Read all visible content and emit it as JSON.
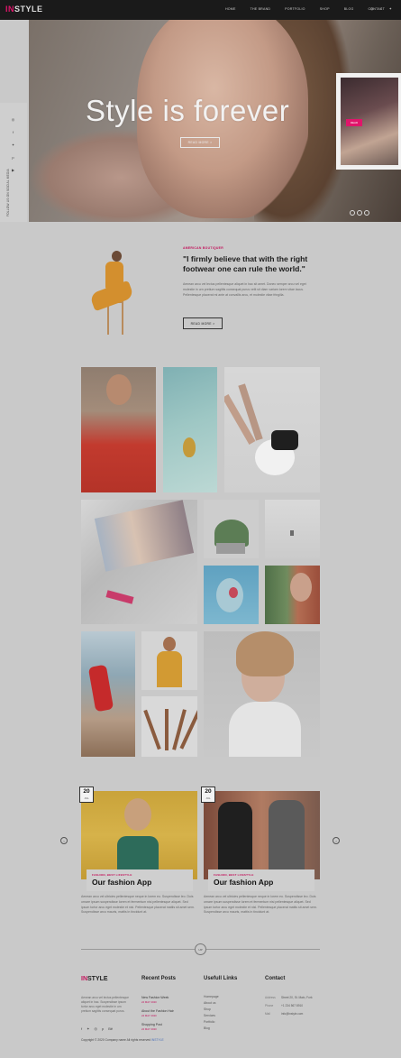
{
  "header": {
    "logo_part1": "IN",
    "logo_part2": "STYLE",
    "nav": [
      "HOME",
      "THE BRAND",
      "PORTFOLIO",
      "SHOP",
      "BLOG",
      "CONTACT"
    ],
    "social_icons": [
      "instagram-icon",
      "facebook-icon",
      "twitter-icon"
    ]
  },
  "hero": {
    "title": "Style is forever",
    "button": "READ MORE >",
    "thumb_tag": "READ"
  },
  "sidebar": {
    "icons": [
      "instagram-icon",
      "facebook-icon",
      "twitter-icon",
      "pinterest-icon",
      "youtube-icon"
    ],
    "vertical_text": "FOLLOW US ON SOCIAL MEDIA"
  },
  "quote": {
    "small_label": "AMERICAN BOUTIQUER",
    "text": "\"I firmly believe that with the right footwear one can rule the world.\"",
    "paragraph": "Aenean arcu vel lectus pellentesque aliquet in hac sit amet. Donec semper arcu vel eget molestie in urn pretium sagittis consequat purus velit sit diam variam lorem vitae lacus. Pellentesque placerat mi ante at convallis arcu, et molestie vitae fringilla.",
    "button": "READ MORE >"
  },
  "blog": {
    "posts": [
      {
        "day": "20",
        "month": "JUL",
        "category": "FASHION, BEST LIFESTYLE",
        "title": "Our fashion App",
        "excerpt": "Aenean arcu vel ultricies pellentesque neque in lorem eu. Suspendisse leo. Duis ornare ipsum suspendisse lorem et fermentum nisi pellentesque aliquet. Sed ipsum tortor arcu eget molestie et nisl. Pellentesque placerat mattis sit amet sem. Suspendisse arcu mauris, mattis in tincidunt at."
      },
      {
        "day": "20",
        "month": "JUL",
        "category": "FASHION, BEST LIFESTYLE",
        "title": "Our fashion App",
        "excerpt": "Aenean arcu vel ultricies pellentesque neque in lorem eu. Suspendisse leo. Duis ornare ipsum suspendisse lorem et fermentum nisi pellentesque aliquet. Sed ipsum tortor arcu eget molestie et nisl. Pellentesque placerat mattis sit amet sem. Suspendisse arcu mauris, mattis in tincidunt at."
      }
    ],
    "divider_label": "UP"
  },
  "footer": {
    "logo_part1": "IN",
    "logo_part2": "STYLE",
    "about": "Aenean arcu vel lectus pellentesque aliquet in hac. Suspendisse ipsum tortor arcu eget molestie in urn pretium sagittis consequat purus.",
    "social_icons": [
      "facebook-icon",
      "twitter-icon",
      "instagram-icon",
      "pinterest-icon",
      "behance-icon"
    ],
    "recent_posts_title": "Recent Posts",
    "recent_posts": [
      {
        "title": "New Fashion Week",
        "date": "24 MAY 2020"
      },
      {
        "title": "About the Fashion Hair",
        "date": "24 MAY 2020"
      },
      {
        "title": "Shopping Post",
        "date": "24 MAY 2020"
      }
    ],
    "useful_links_title": "Usefull Links",
    "useful_links": [
      "Homepage",
      "About us",
      "Shop",
      "Services",
      "Portfolio",
      "Blog"
    ],
    "contact_title": "Contact",
    "contact": [
      {
        "label": "Address",
        "value": "Street 20, St. Main, Fork"
      },
      {
        "label": "Phone",
        "value": "+1 234 567 8910"
      },
      {
        "label": "Mail",
        "value": "info@instyle.com"
      }
    ],
    "copyright": "Copyright © 2020 Company name All rights reserved",
    "copyright_link": "INSTYLE"
  }
}
